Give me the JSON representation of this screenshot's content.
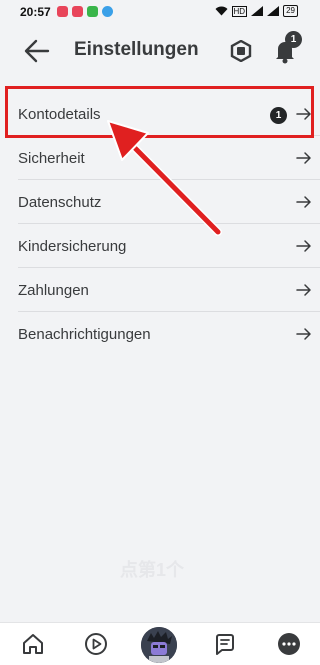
{
  "status": {
    "time": "20:57",
    "network": "HD",
    "battery": "29"
  },
  "header": {
    "title": "Einstellungen",
    "notification_count": "1"
  },
  "settings": {
    "items": [
      {
        "label": "Kontodetails",
        "badge": "1"
      },
      {
        "label": "Sicherheit"
      },
      {
        "label": "Datenschutz"
      },
      {
        "label": "Kindersicherung"
      },
      {
        "label": "Zahlungen"
      },
      {
        "label": "Benachrichtigungen"
      }
    ]
  },
  "watermark": "点第1个",
  "colors": {
    "highlight": "#e02020",
    "background": "#f2f3f5",
    "text": "#393b3d"
  },
  "icons": {
    "back": "arrow-left-icon",
    "robux": "robux-icon",
    "notifications": "bell-icon",
    "row_arrow": "arrow-right-icon",
    "nav": [
      "home-icon",
      "play-icon",
      "avatar",
      "chat-icon",
      "more-icon"
    ]
  }
}
